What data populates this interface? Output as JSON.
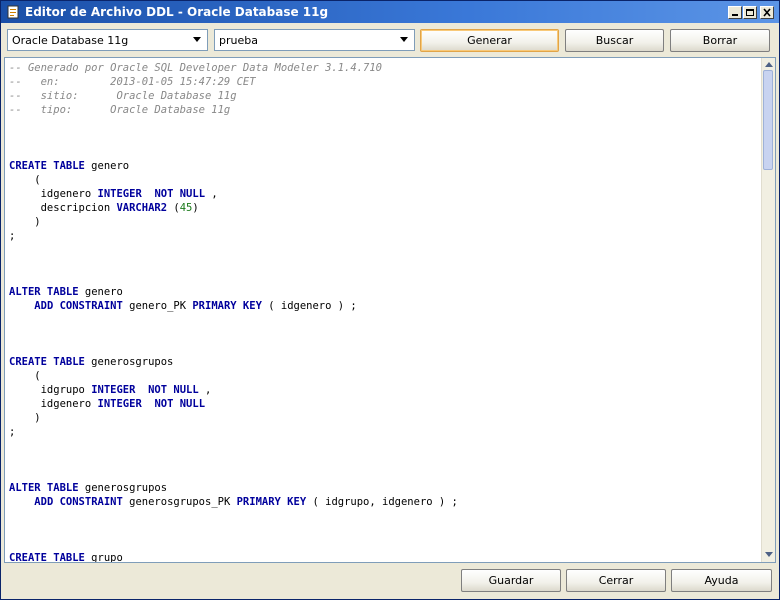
{
  "window": {
    "title": "Editor de Archivo DDL - Oracle Database 11g"
  },
  "toolbar": {
    "database_select": "Oracle Database 11g",
    "design_select": "prueba",
    "generate_label": "Generar",
    "search_label": "Buscar",
    "clear_label": "Borrar"
  },
  "editor": {
    "lines": [
      [
        {
          "t": "-- Generado por Oracle SQL Developer Data Modeler 3.1.4.710",
          "c": "comment"
        }
      ],
      [
        {
          "t": "--   en:        2013-01-05 15:47:29 CET",
          "c": "comment"
        }
      ],
      [
        {
          "t": "--   sitio:      Oracle Database 11g",
          "c": "comment"
        }
      ],
      [
        {
          "t": "--   tipo:      Oracle Database 11g",
          "c": "comment"
        }
      ],
      [],
      [],
      [],
      [
        {
          "t": "CREATE TABLE",
          "c": "kw"
        },
        {
          "t": " genero",
          "c": ""
        }
      ],
      [
        {
          "t": "    (",
          "c": ""
        }
      ],
      [
        {
          "t": "     idgenero ",
          "c": ""
        },
        {
          "t": "INTEGER",
          "c": "kw"
        },
        {
          "t": "  ",
          "c": ""
        },
        {
          "t": "NOT NULL",
          "c": "kw"
        },
        {
          "t": " ,",
          "c": ""
        }
      ],
      [
        {
          "t": "     descripcion ",
          "c": ""
        },
        {
          "t": "VARCHAR2",
          "c": "kw"
        },
        {
          "t": " (",
          "c": ""
        },
        {
          "t": "45",
          "c": "num"
        },
        {
          "t": ")",
          "c": ""
        }
      ],
      [
        {
          "t": "    )",
          "c": ""
        }
      ],
      [
        {
          "t": ";",
          "c": ""
        }
      ],
      [],
      [],
      [],
      [
        {
          "t": "ALTER TABLE",
          "c": "kw"
        },
        {
          "t": " genero",
          "c": ""
        }
      ],
      [
        {
          "t": "    ",
          "c": ""
        },
        {
          "t": "ADD CONSTRAINT",
          "c": "kw"
        },
        {
          "t": " genero_PK ",
          "c": ""
        },
        {
          "t": "PRIMARY KEY",
          "c": "kw"
        },
        {
          "t": " ( idgenero ) ;",
          "c": ""
        }
      ],
      [],
      [],
      [],
      [
        {
          "t": "CREATE TABLE",
          "c": "kw"
        },
        {
          "t": " generosgrupos",
          "c": ""
        }
      ],
      [
        {
          "t": "    (",
          "c": ""
        }
      ],
      [
        {
          "t": "     idgrupo ",
          "c": ""
        },
        {
          "t": "INTEGER",
          "c": "kw"
        },
        {
          "t": "  ",
          "c": ""
        },
        {
          "t": "NOT NULL",
          "c": "kw"
        },
        {
          "t": " ,",
          "c": ""
        }
      ],
      [
        {
          "t": "     idgenero ",
          "c": ""
        },
        {
          "t": "INTEGER",
          "c": "kw"
        },
        {
          "t": "  ",
          "c": ""
        },
        {
          "t": "NOT NULL",
          "c": "kw"
        }
      ],
      [
        {
          "t": "    )",
          "c": ""
        }
      ],
      [
        {
          "t": ";",
          "c": ""
        }
      ],
      [],
      [],
      [],
      [
        {
          "t": "ALTER TABLE",
          "c": "kw"
        },
        {
          "t": " generosgrupos",
          "c": ""
        }
      ],
      [
        {
          "t": "    ",
          "c": ""
        },
        {
          "t": "ADD CONSTRAINT",
          "c": "kw"
        },
        {
          "t": " generosgrupos_PK ",
          "c": ""
        },
        {
          "t": "PRIMARY KEY",
          "c": "kw"
        },
        {
          "t": " ( idgrupo, idgenero ) ;",
          "c": ""
        }
      ],
      [],
      [],
      [],
      [
        {
          "t": "CREATE TABLE",
          "c": "kw"
        },
        {
          "t": " grupo",
          "c": ""
        }
      ]
    ]
  },
  "footer": {
    "save_label": "Guardar",
    "close_label": "Cerrar",
    "help_label": "Ayuda"
  },
  "colors": {
    "keyword": "#00009c",
    "comment": "#888888",
    "number": "#1a7a1a",
    "titlebar": "#3a78d8"
  }
}
